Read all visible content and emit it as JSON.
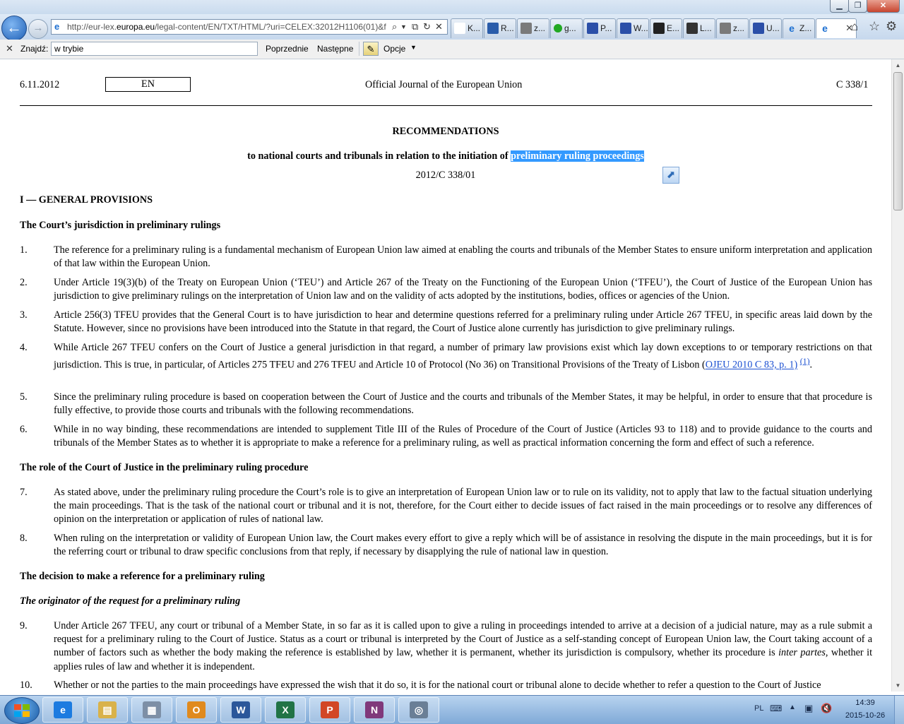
{
  "browser": {
    "window_title": "",
    "url_pre": "http://eur-lex.",
    "url_domain": "europa.eu",
    "url_post": "/legal-content/EN/TXT/HTML/?uri=CELEX:32012H1106(01)&f",
    "tabs": [
      {
        "label": "K...",
        "icon": "pme-icon",
        "color": "#ffffff"
      },
      {
        "label": "R...",
        "icon": "lens-icon",
        "color": "#2a5caa"
      },
      {
        "label": "z...",
        "icon": "chat-icon",
        "color": "#7a7a7a"
      },
      {
        "label": "g...",
        "icon": "green-dot-icon",
        "color": "#22a822"
      },
      {
        "label": "P...",
        "icon": "owl-icon",
        "color": "#2b4fa8"
      },
      {
        "label": "W...",
        "icon": "owl-icon",
        "color": "#2b4fa8"
      },
      {
        "label": "E...",
        "icon": "building-icon",
        "color": "#222222"
      },
      {
        "label": "L...",
        "icon": "mountain-icon",
        "color": "#333333"
      },
      {
        "label": "z...",
        "icon": "chat-icon",
        "color": "#7a7a7a"
      },
      {
        "label": "U...",
        "icon": "owl-icon",
        "color": "#2b4fa8"
      },
      {
        "label": "Z...",
        "icon": "ie-icon",
        "color": "#1c6fd1"
      },
      {
        "label": "",
        "icon": "ie-icon",
        "color": "#1c6fd1",
        "active": true
      }
    ]
  },
  "findbar": {
    "label": "Znajdź:",
    "value": "w trybie",
    "prev": "Poprzednie",
    "next": "Następne",
    "options": "Opcje"
  },
  "document": {
    "header": {
      "date": "6.11.2012",
      "lang": "EN",
      "journal": "Official Journal of the European Union",
      "ref": "C 338/1"
    },
    "title": "RECOMMENDATIONS",
    "subtitle_pre": "to national courts and tribunals in relation to the initiation of ",
    "subtitle_highlight": "preliminary ruling proceedings",
    "number": "2012/C 338/01",
    "section_1": "I —   GENERAL PROVISIONS",
    "heading_jurisdiction": "The Court’s jurisdiction in preliminary rulings",
    "heading_role": "The role of the Court of Justice in the preliminary ruling procedure",
    "heading_decision": "The decision to make a reference for a preliminary ruling",
    "heading_originator": "The originator of the request for a preliminary ruling",
    "paragraphs": {
      "p1": {
        "num": "1.",
        "text": "The reference for a preliminary ruling is a fundamental mechanism of European Union law aimed at enabling the courts and tribunals of the Member States to ensure uniform interpretation and application of that law within the European Union."
      },
      "p2": {
        "num": "2.",
        "text": "Under Article 19(3)(b) of the Treaty on European Union (‘TEU’) and Article 267 of the Treaty on the Functioning of the European Union (‘TFEU’), the Court of Justice of the European Union has jurisdiction to give preliminary rulings on the interpretation of Union law and on the validity of acts adopted by the institutions, bodies, offices or agencies of the Union."
      },
      "p3": {
        "num": "3.",
        "text": "Article 256(3) TFEU provides that the General Court is to have jurisdiction to hear and determine questions referred for a preliminary ruling under Article 267 TFEU, in specific areas laid down by the Statute. However, since no provisions have been introduced into the Statute in that regard, the Court of Justice alone currently has jurisdiction to give preliminary rulings."
      },
      "p4": {
        "num": "4.",
        "text": "While Article 267 TFEU confers on the Court of Justice a general jurisdiction in that regard, a number of primary law provisions exist which lay down exceptions to or temporary restrictions on that jurisdiction. This is true, in particular, of Articles 275 TFEU and 276 TFEU and Article 10 of Protocol (No 36) on Transitional Provisions of the Treaty of Lisbon (",
        "link": "OJEU 2010 C 83, p. 1)",
        "ref": "(1)",
        "end": "."
      },
      "p5": {
        "num": "5.",
        "text": "Since the preliminary ruling procedure is based on cooperation between the Court of Justice and the courts and tribunals of the Member States, it may be helpful, in order to ensure that that procedure is fully effective, to provide those courts and tribunals with the following recommendations."
      },
      "p6": {
        "num": "6.",
        "text": "While in no way binding, these recommendations are intended to supplement Title III of the Rules of Procedure of the Court of Justice (Articles 93 to 118) and to provide guidance to the courts and tribunals of the Member States as to whether it is appropriate to make a reference for a preliminary ruling, as well as practical information concerning the form and effect of such a reference."
      },
      "p7": {
        "num": "7.",
        "text": "As stated above, under the preliminary ruling procedure the Court’s role is to give an interpretation of European Union law or to rule on its validity, not to apply that law to the factual situation underlying the main proceedings. That is the task of the national court or tribunal and it is not, therefore, for the Court either to decide issues of fact raised in the main proceedings or to resolve any differences of opinion on the interpretation or application of rules of national law."
      },
      "p8": {
        "num": "8.",
        "text": "When ruling on the interpretation or validity of European Union law, the Court makes every effort to give a reply which will be of assistance in resolving the dispute in the main proceedings, but it is for the referring court or tribunal to draw specific conclusions from that reply, if necessary by disapplying the rule of national law in question."
      },
      "p9": {
        "num": "9.",
        "text": "Under Article 267 TFEU, any court or tribunal of a Member State, in so far as it is called upon to give a ruling in proceedings intended to arrive at a decision of a judicial nature, may as a rule submit a request for a preliminary ruling to the Court of Justice. Status as a court or tribunal is interpreted by the Court of Justice as a self-standing concept of European Union law, the Court taking account of a number of factors such as whether the body making the reference is established by law, whether it is permanent, whether its jurisdiction is compulsory, whether its procedure is ",
        "italic": "inter partes",
        "end": ", whether it applies rules of law and whether it is independent."
      },
      "p10": {
        "num": "10.",
        "text": "Whether or not the parties to the main proceedings have expressed the wish that it do so, it is for the national court or tribunal alone to decide whether to refer a question to the Court of Justice"
      }
    }
  },
  "taskbar": {
    "apps": [
      {
        "name": "internet-explorer",
        "glyph": "e",
        "color": "#1c7be0"
      },
      {
        "name": "file-explorer",
        "glyph": "▤",
        "color": "#d9b24a"
      },
      {
        "name": "calculator",
        "glyph": "▦",
        "color": "#7d8fa6"
      },
      {
        "name": "outlook",
        "glyph": "O",
        "color": "#e08a1e"
      },
      {
        "name": "word",
        "glyph": "W",
        "color": "#2b579a"
      },
      {
        "name": "excel",
        "glyph": "X",
        "color": "#217346"
      },
      {
        "name": "powerpoint",
        "glyph": "P",
        "color": "#d24726"
      },
      {
        "name": "onenote",
        "glyph": "N",
        "color": "#80397b"
      },
      {
        "name": "globe-app",
        "glyph": "◎",
        "color": "#6a7f96"
      }
    ],
    "lang": "PL",
    "time": "14:39",
    "date": "2015-10-26"
  }
}
